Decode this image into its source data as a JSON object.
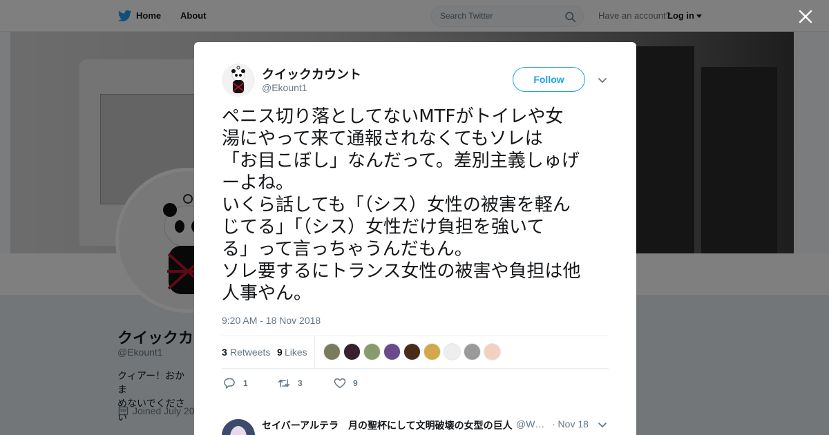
{
  "nav": {
    "home": "Home",
    "about": "About",
    "search_placeholder": "Search Twitter",
    "have_account": "Have an account?",
    "login": "Log in"
  },
  "profile": {
    "name": "クイックカ",
    "handle": "@Ekount1",
    "bio": "クィアー！おかま\nめないでくださ い",
    "joined": "Joined July 20"
  },
  "tweet": {
    "author_name": "クイックカウント",
    "author_handle": "@Ekount1",
    "follow_label": "Follow",
    "lines": [
      "ペニス切り落としてないMTFがトイレや女",
      "湯にやって来て通報されなくてもソレは",
      "「お目こぼし」なんだって。差別主義しゅげ",
      "ーよね。",
      "いくら話しても「（シス）女性の被害を軽ん",
      "じてる」「（シス）女性だけ負担を強いて",
      "る」って言っちゃうんだもん。",
      "ソレ要するにトランス女性の被害や負担は他",
      "人事やん。"
    ],
    "timestamp": "9:20 AM - 18 Nov 2018",
    "retweets_count": "3",
    "retweets_label": "Retweets",
    "likes_count": "9",
    "likes_label": "Likes",
    "actions": {
      "reply_count": "1",
      "retweet_count": "3",
      "like_count": "9"
    },
    "liker_colors": [
      "#7a7a5c",
      "#3a1f2e",
      "#8a9a6a",
      "#6a4a8a",
      "#4a2a1a",
      "#d4a84a",
      "#eeeeee",
      "#9a9a9a",
      "#f4d0c0"
    ]
  },
  "reply": {
    "name": "セイバーアルテラ　月の聖杯にして文明破壊の女型の巨人",
    "handle": "@W…",
    "date": "· Nov 18"
  },
  "colors": {
    "twitter_blue": "#1da1f2",
    "text_primary": "#14171a",
    "text_secondary": "#657786"
  }
}
